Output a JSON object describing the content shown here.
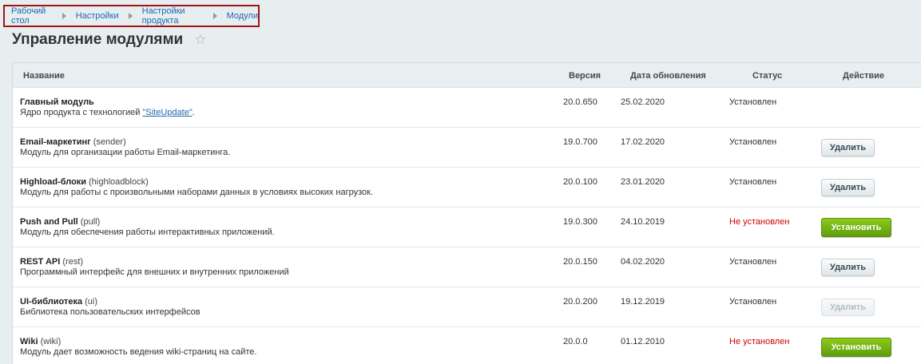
{
  "breadcrumbs": [
    "Рабочий стол",
    "Настройки",
    "Настройки продукта",
    "Модули"
  ],
  "page_title": "Управление модулями",
  "table": {
    "headers": {
      "name": "Название",
      "version": "Версия",
      "date": "Дата обновления",
      "status": "Статус",
      "action": "Действие"
    },
    "rows": [
      {
        "title": "Главный модуль",
        "code": "",
        "desc_prefix": "Ядро продукта с технологией ",
        "desc_link": "\"SiteUpdate\"",
        "desc_suffix": ".",
        "version": "20.0.650",
        "date": "25.02.2020",
        "status": "Установлен"
      },
      {
        "title": "Email-маркетинг",
        "code": "(sender)",
        "desc": "Модуль для организации работы Email-маркетинга.",
        "version": "19.0.700",
        "date": "17.02.2020",
        "status": "Установлен",
        "action": "Удалить"
      },
      {
        "title": "Highload-блоки",
        "code": "(highloadblock)",
        "desc": "Модуль для работы с произвольными наборами данных в условиях высоких нагрузок.",
        "version": "20.0.100",
        "date": "23.01.2020",
        "status": "Установлен",
        "action": "Удалить"
      },
      {
        "title": "Push and Pull",
        "code": "(pull)",
        "desc": "Модуль для обеспечения работы интерактивных приложений.",
        "version": "19.0.300",
        "date": "24.10.2019",
        "status": "Не установлен",
        "action": "Установить"
      },
      {
        "title": "REST API",
        "code": "(rest)",
        "desc": "Программный интерфейс для внешних и внутренних приложений",
        "version": "20.0.150",
        "date": "04.02.2020",
        "status": "Установлен",
        "action": "Удалить"
      },
      {
        "title": "UI-библиотека",
        "code": "(ui)",
        "desc": "Библиотека пользовательских интерфейсов",
        "version": "20.0.200",
        "date": "19.12.2019",
        "status": "Установлен",
        "action": "Удалить"
      },
      {
        "title": "Wiki",
        "code": "(wiki)",
        "desc": "Модуль дает возможность ведения wiki-страниц на сайте.",
        "version": "20.0.0",
        "date": "01.12.2010",
        "status": "Не установлен",
        "action": "Установить"
      }
    ]
  },
  "colors": {
    "page_bg": "#e7eef0",
    "link": "#2067b0",
    "status_not_installed": "#d20000",
    "install_button": "#6fb012",
    "breadcrumb_highlight": "#9d1519"
  },
  "icons": {
    "favorite": "star-outline-icon",
    "breadcrumb_separator": "triangle-right-icon"
  }
}
